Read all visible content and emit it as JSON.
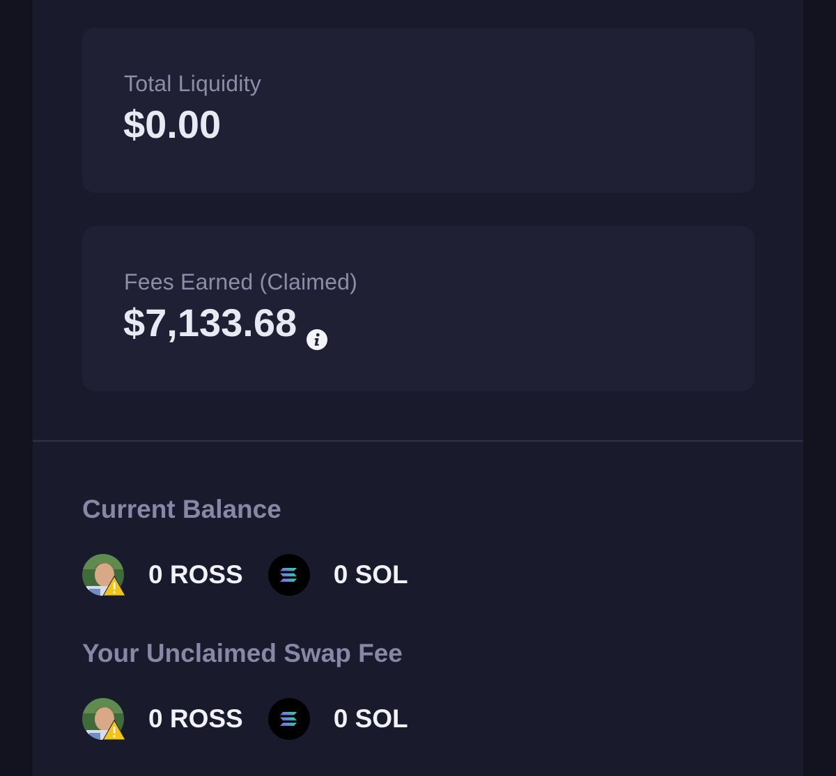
{
  "cards": {
    "total_liquidity": {
      "label": "Total Liquidity",
      "value": "$0.00"
    },
    "fees_earned": {
      "label": "Fees Earned (Claimed)",
      "value": "$7,133.68",
      "icon": "info-icon"
    }
  },
  "current_balance": {
    "title": "Current Balance",
    "tokens": [
      {
        "amount": "0 ROSS",
        "icon": "ross-token-avatar-warning-icon"
      },
      {
        "amount": "0 SOL",
        "icon": "solana-logo-icon"
      }
    ]
  },
  "unclaimed_fee": {
    "title": "Your Unclaimed Swap Fee",
    "tokens": [
      {
        "amount": "0 ROSS",
        "icon": "ross-token-avatar-warning-icon"
      },
      {
        "amount": "0 SOL",
        "icon": "solana-logo-icon"
      }
    ]
  },
  "colors": {
    "background": "#12131f",
    "panel": "#191a2c",
    "card": "#1f2033",
    "label": "#8d8da9",
    "value": "#e9e9f3",
    "warning": "#f2c418"
  }
}
